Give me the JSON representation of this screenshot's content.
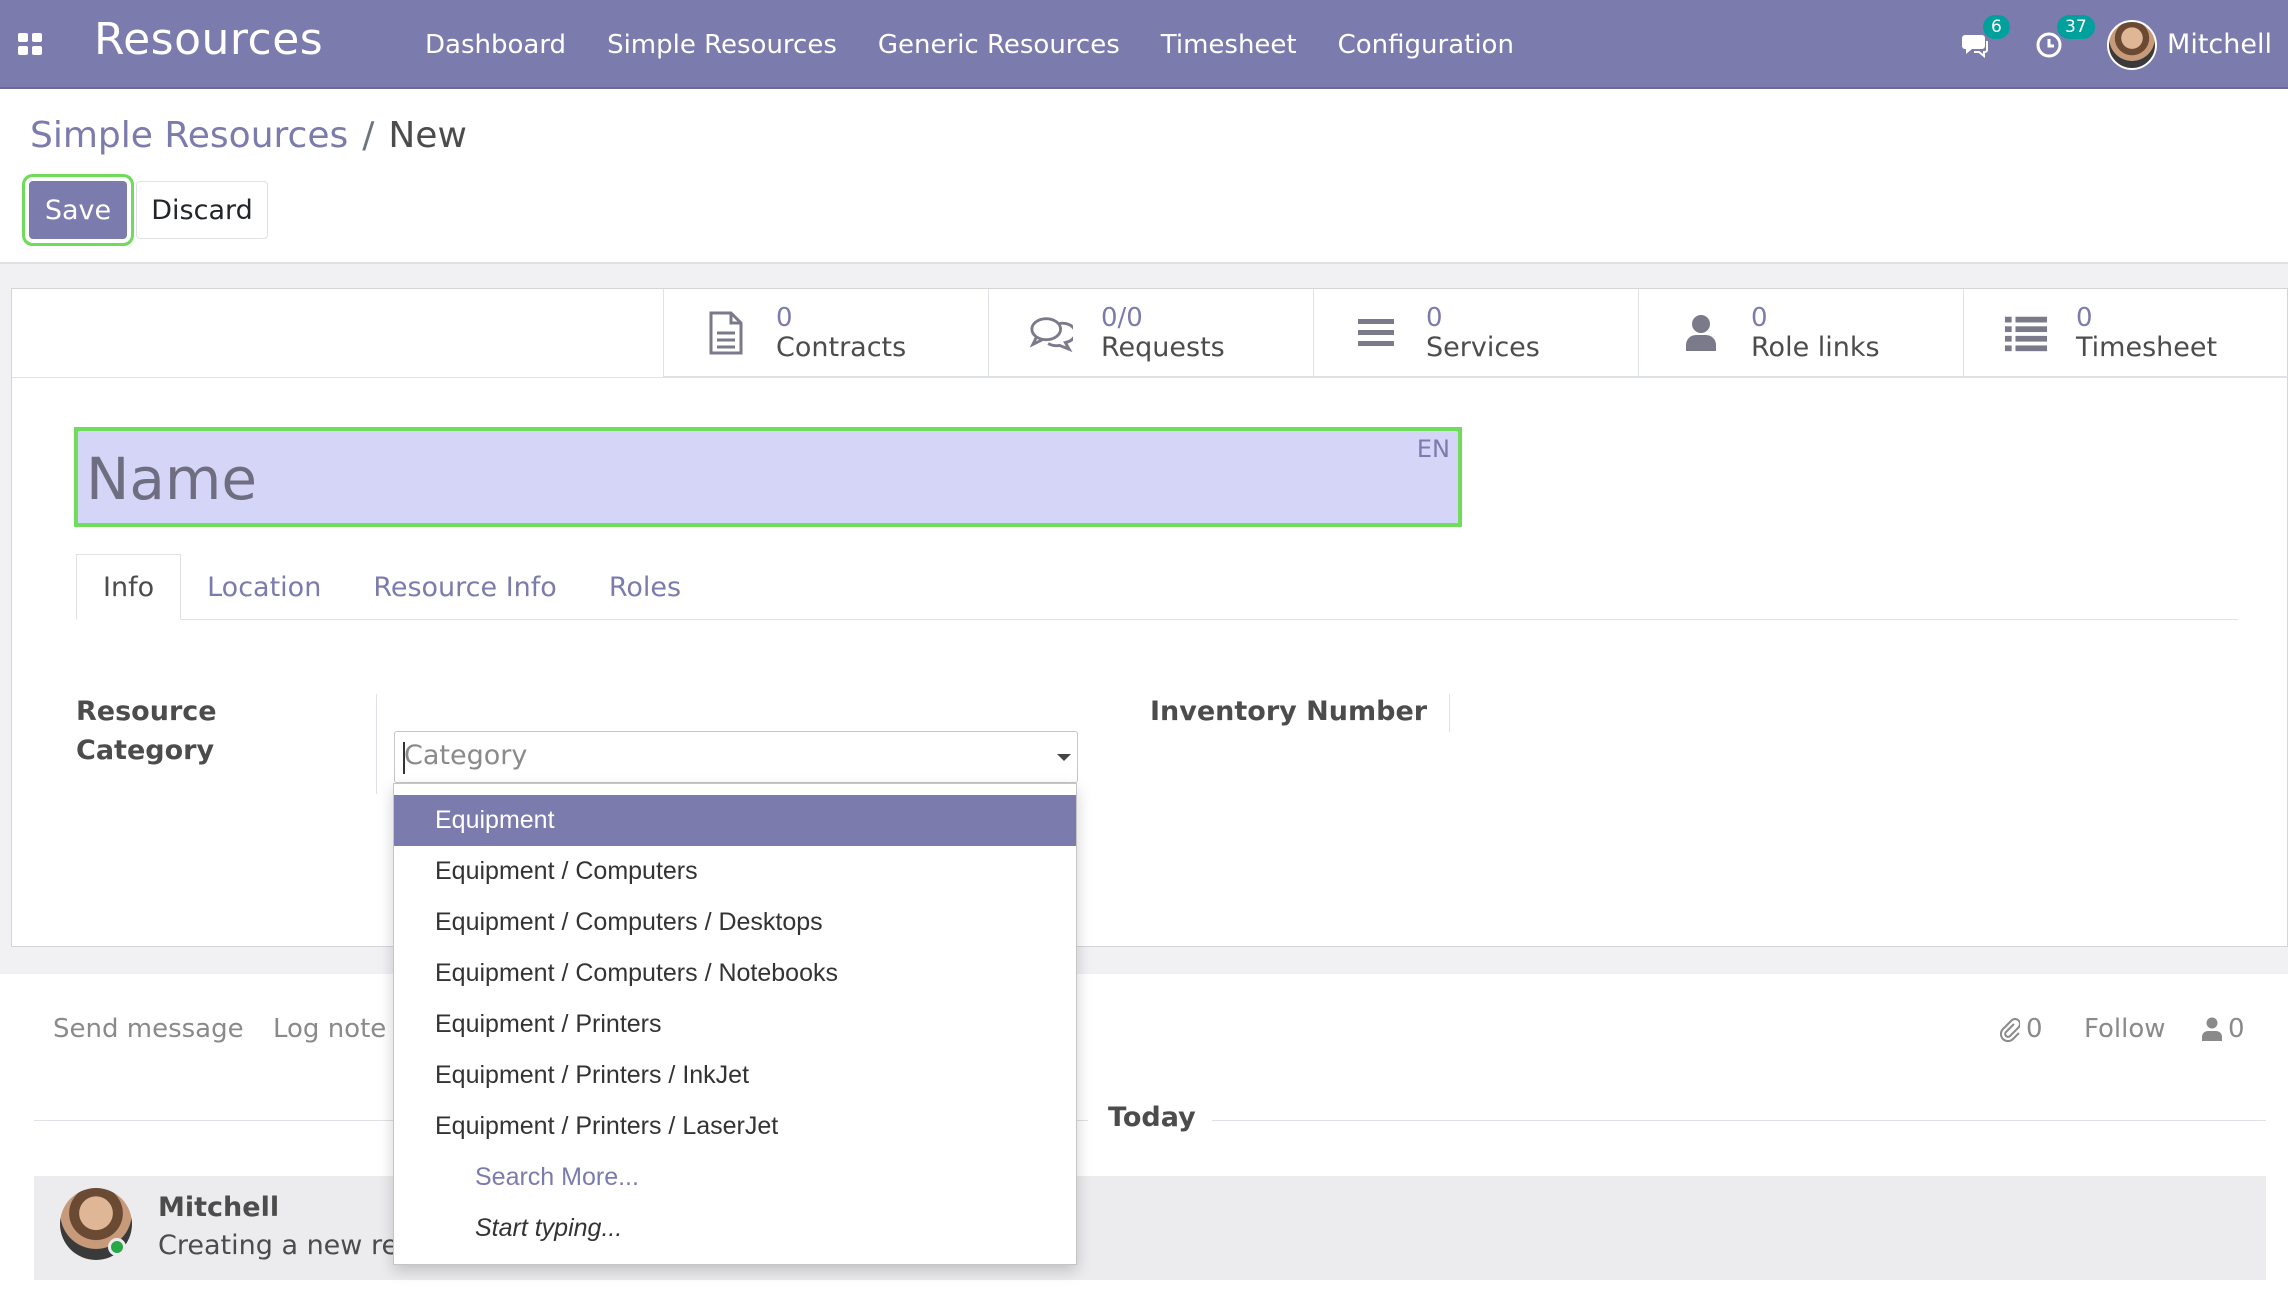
{
  "navbar": {
    "app_title": "Resources",
    "menu": [
      "Dashboard",
      "Simple Resources",
      "Generic Resources",
      "Timesheet",
      "Configuration"
    ],
    "messages_count": "6",
    "activities_count": "37",
    "user_name": "Mitchell",
    "bg_color": "#7c7bad"
  },
  "breadcrumb": {
    "parent": "Simple Resources",
    "separator": "/",
    "current": "New"
  },
  "actions": {
    "save": "Save",
    "discard": "Discard"
  },
  "stat_buttons": [
    {
      "value": "0",
      "label": "Contracts",
      "icon": "file-icon"
    },
    {
      "value": "0/0",
      "label": "Requests",
      "icon": "comments-icon"
    },
    {
      "value": "0",
      "label": "Services",
      "icon": "bars-icon"
    },
    {
      "value": "0",
      "label": "Role links",
      "icon": "user-icon"
    },
    {
      "value": "0",
      "label": "Timesheet",
      "icon": "list-icon"
    }
  ],
  "form": {
    "name_placeholder": "Name",
    "lang": "EN",
    "tabs": [
      "Info",
      "Location",
      "Resource Info",
      "Roles"
    ],
    "active_tab": "Info",
    "resource_category_label": "Resource Category",
    "resource_category_line1": "Resource",
    "resource_category_line2": "Category",
    "category_placeholder": "Category",
    "inventory_number_label": "Inventory Number"
  },
  "category_dropdown": {
    "options": [
      "Equipment",
      "Equipment / Computers",
      "Equipment / Computers / Desktops",
      "Equipment / Computers / Notebooks",
      "Equipment / Printers",
      "Equipment / Printers / InkJet",
      "Equipment / Printers / LaserJet"
    ],
    "selected": "Equipment",
    "search_more": "Search More...",
    "hint": "Start typing..."
  },
  "chatter": {
    "send_message": "Send message",
    "log_note": "Log note",
    "attachments_count": "0",
    "follow": "Follow",
    "followers_count": "0",
    "date_separator": "Today",
    "message": {
      "author": "Mitchell",
      "body": "Creating a new record..."
    }
  }
}
